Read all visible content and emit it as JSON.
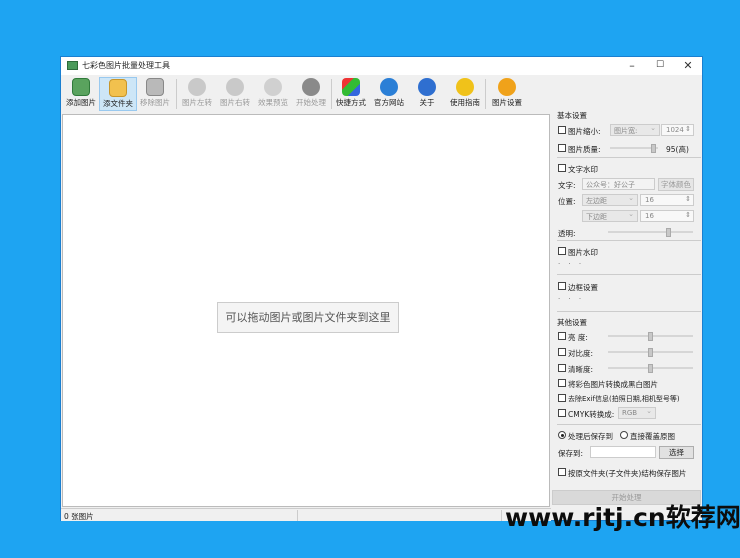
{
  "window": {
    "title": "七彩色图片批量处理工具",
    "controls": {
      "minimize": "–",
      "maximize": "☐",
      "close": "✕"
    }
  },
  "toolbar": {
    "add_image": "添加图片",
    "add_folder": "添文件夹",
    "remove_image": "移除图片",
    "rotate_left": "图片左转",
    "rotate_right": "图片右转",
    "preview": "效果预览",
    "start": "开始处理",
    "shortcut": "快捷方式",
    "website": "官方网站",
    "about": "关于",
    "guide": "使用指南",
    "settings": "图片设置"
  },
  "drop_area": {
    "hint": "可以拖动图片或图片文件夹到这里"
  },
  "status": {
    "count": "0 张图片"
  },
  "panel": {
    "basic": {
      "heading": "基本设置",
      "resize_label": "图片缩小:",
      "resize_mode": "图片宽:",
      "resize_value": "1024",
      "quality_label": "图片质量:",
      "quality_value": "95(高)",
      "quality_level": 0.95
    },
    "text_wm": {
      "heading": "文字水印",
      "text_label": "文字:",
      "text_value": "公众号：好公子",
      "font_color_button": "字体颜色",
      "position_label": "位置:",
      "h_pos": "左边距",
      "h_val": "16",
      "v_pos": "下边距",
      "v_val": "16",
      "opacity_label": "透明:"
    },
    "image_wm": {
      "heading": "图片水印",
      "dots": "· · ·"
    },
    "border": {
      "heading": "边框设置",
      "dots": "· · ·"
    },
    "other": {
      "heading": "其他设置",
      "brightness": "亮    度:",
      "contrast": "对比度:",
      "sharpness": "清晰度:",
      "grayscale": "将彩色图片转换成黑白图片",
      "remove_exif": "去除Exif信息(拍照日期,相机型号等)",
      "cmyk": "CMYK转换成:",
      "cmyk_value": "RGB"
    },
    "output": {
      "save_after": "处理后保存到",
      "overwrite": "直接覆盖原图",
      "save_to_label": "保存到:",
      "save_to_value": "",
      "choose_button": "选择",
      "keep_structure": "按原文件夹(子文件夹)结构保存图片"
    },
    "start_button": "开始处理"
  },
  "watermark": "www.rjtj.cn软荐网",
  "colors": {
    "background": "#1ea4f2",
    "window_border": "#1a7fd0"
  }
}
